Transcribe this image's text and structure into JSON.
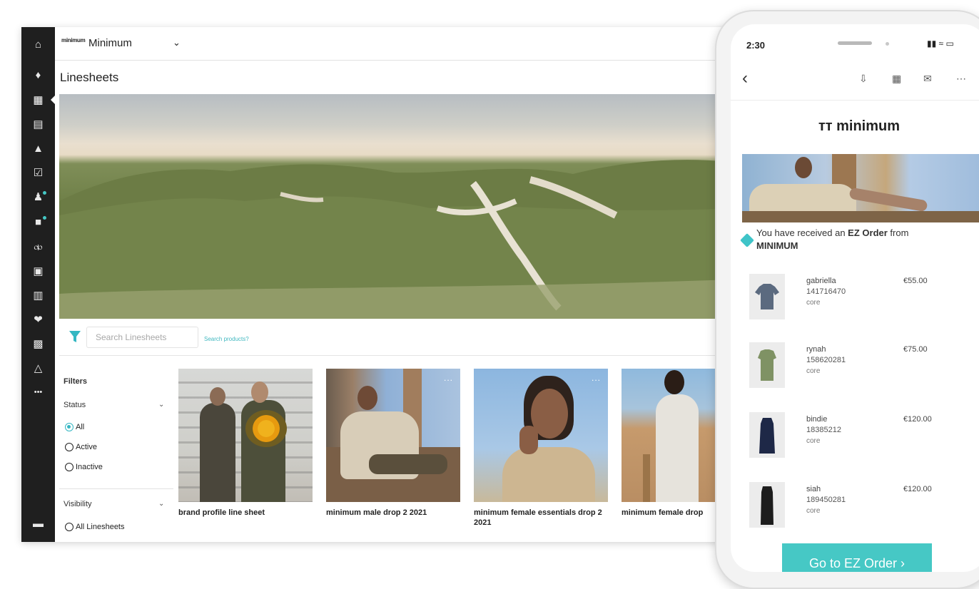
{
  "app": {
    "brand_logo_text": "minimum",
    "brand_name": "Minimum",
    "page_title": "Linesheets",
    "sidebar_icons": [
      "home-icon",
      "tag-icon",
      "linesheet-icon",
      "catalog-icon",
      "presentation-icon",
      "checklist-icon",
      "users-icon",
      "box-icon",
      "discount-icon",
      "media-icon",
      "analytics-icon",
      "handshake-icon",
      "showroom-icon",
      "brand-icon",
      "more-icon",
      "flag-icon"
    ],
    "search": {
      "placeholder": "Search Linesheets",
      "link": "Search products?"
    },
    "filters": {
      "title": "Filters",
      "status_label": "Status",
      "status_options": [
        "All",
        "Active",
        "Inactive"
      ],
      "status_selected": "All",
      "visibility_label": "Visibility",
      "visibility_options": [
        "All Linesheets"
      ]
    },
    "cards": [
      {
        "title": "brand profile line sheet"
      },
      {
        "title": "minimum male drop 2 2021"
      },
      {
        "title": "minimum female essentials drop 2 2021"
      },
      {
        "title": "minimum female drop"
      }
    ],
    "more_label": "..."
  },
  "phone": {
    "time": "2:30",
    "logo": "minimum",
    "message_prefix": "You have received an ",
    "message_bold": "EZ Order",
    "message_mid": " from ",
    "message_sender": "MINIMUM",
    "items": [
      {
        "name": "gabriella",
        "code": "141716470",
        "category": "core",
        "price": "€55.00",
        "color": "#5b6a7f"
      },
      {
        "name": "rynah",
        "code": "158620281",
        "category": "core",
        "price": "€75.00",
        "color": "#7f9264"
      },
      {
        "name": "bindie",
        "code": "18385212",
        "category": "core",
        "price": "€120.00",
        "color": "#1e2847"
      },
      {
        "name": "siah",
        "code": "189450281",
        "category": "core",
        "price": "€120.00",
        "color": "#1d1d1d"
      }
    ],
    "cta": "Go to EZ Order ›",
    "accent": "#46c8c5"
  }
}
